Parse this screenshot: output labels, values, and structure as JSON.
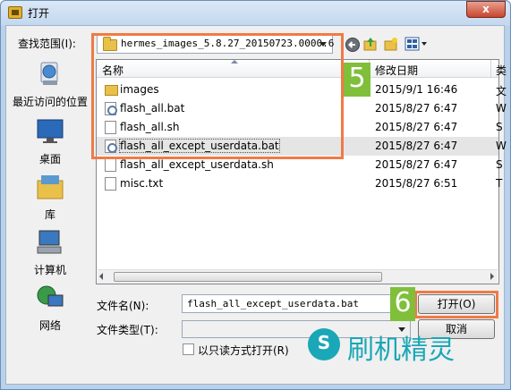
{
  "window": {
    "title": "打开",
    "close_label": "x"
  },
  "lookin": {
    "label": "查找范围(I):",
    "path": "hermes_images_5.8.27_20150723.0000.6"
  },
  "places": [
    {
      "label": "最近访问的位置",
      "icon": "recent-places-icon"
    },
    {
      "label": "桌面",
      "icon": "desktop-icon"
    },
    {
      "label": "库",
      "icon": "libraries-icon"
    },
    {
      "label": "计算机",
      "icon": "computer-icon"
    },
    {
      "label": "网络",
      "icon": "network-icon"
    }
  ],
  "columns": {
    "name": "名称",
    "modified": "修改日期",
    "type_partial": "类"
  },
  "files": [
    {
      "name": "images",
      "date": "2015/9/1 16:46",
      "type_partial": "文",
      "kind": "folder"
    },
    {
      "name": "flash_all.bat",
      "date": "2015/8/27 6:47",
      "type_partial": "W",
      "kind": "bat"
    },
    {
      "name": "flash_all.sh",
      "date": "2015/8/27 6:47",
      "type_partial": "S",
      "kind": "file"
    },
    {
      "name": "flash_all_except_userdata.bat",
      "date": "2015/8/27 6:47",
      "type_partial": "W",
      "kind": "bat"
    },
    {
      "name": "flash_all_except_userdata.sh",
      "date": "2015/8/27 6:47",
      "type_partial": "S",
      "kind": "file"
    },
    {
      "name": "misc.txt",
      "date": "2015/8/27 6:51",
      "type_partial": "T",
      "kind": "file"
    }
  ],
  "filename": {
    "label": "文件名(N):",
    "value": "flash_all_except_userdata.bat"
  },
  "filetype": {
    "label": "文件类型(T):",
    "value": ""
  },
  "readonly": {
    "label": "以只读方式打开(R)"
  },
  "buttons": {
    "open": "打开(O)",
    "cancel": "取消"
  },
  "annotations": {
    "step5": "5",
    "step6": "6",
    "highlight_color": "#f07a45",
    "badge_color": "#7fbf3a"
  },
  "watermark": {
    "text": "刷机精灵",
    "color": "#1aa7b7"
  }
}
